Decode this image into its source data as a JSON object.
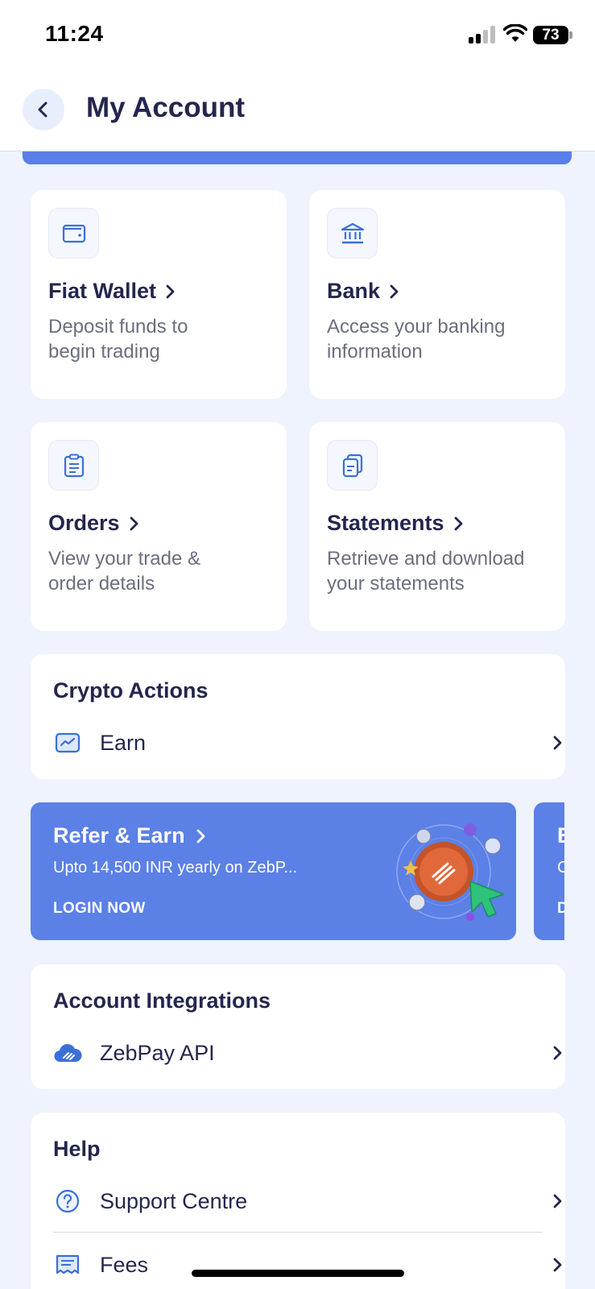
{
  "status_bar": {
    "time": "11:24",
    "battery": "73"
  },
  "header": {
    "title": "My Account",
    "back_icon": "chevron-left-icon"
  },
  "tiles": [
    {
      "title": "Fiat Wallet",
      "desc_line1": "Deposit funds to",
      "desc_line2": "begin trading",
      "icon": "wallet-icon"
    },
    {
      "title": "Bank",
      "desc_line1": "Access your banking",
      "desc_line2": "information",
      "icon": "bank-icon"
    },
    {
      "title": "Orders",
      "desc_line1": "View your trade &",
      "desc_line2": "order details",
      "icon": "clipboard-icon"
    },
    {
      "title": "Statements",
      "desc_line1": "Retrieve and download",
      "desc_line2": "your statements",
      "icon": "documents-icon"
    }
  ],
  "crypto_actions": {
    "title": "Crypto Actions",
    "items": [
      {
        "label": "Earn",
        "icon": "earn-chart-icon"
      }
    ]
  },
  "banner": {
    "title": "Refer & Earn",
    "subtitle": "Upto 14,500 INR yearly on ZebP...",
    "cta": "LOGIN NOW",
    "color": "#5b80e6"
  },
  "banner_peek": {
    "title": "E",
    "subtitle": "C",
    "cta": "D"
  },
  "account_integrations": {
    "title": "Account Integrations",
    "items": [
      {
        "label": "ZebPay API",
        "icon": "cloud-api-icon"
      }
    ]
  },
  "help": {
    "title": "Help",
    "items": [
      {
        "label": "Support Centre",
        "icon": "question-circle-icon"
      },
      {
        "label": "Fees",
        "icon": "receipt-icon"
      }
    ]
  },
  "colors": {
    "accent": "#5b80e6",
    "icon_blue": "#3b6fd8",
    "title_text": "#23274d",
    "muted_text": "#6b6e7e",
    "background": "#eef3fd"
  }
}
